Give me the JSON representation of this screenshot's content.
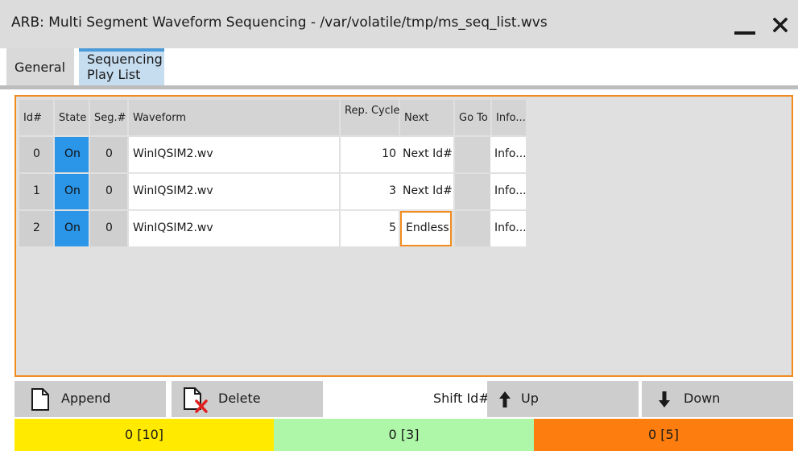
{
  "window": {
    "title": "ARB: Multi Segment Waveform Sequencing - /var/volatile/tmp/ms_seq_list.wvs",
    "minimize_icon": "minimize-icon",
    "close_icon": "close-icon"
  },
  "tabs": [
    {
      "label": "General",
      "active": false
    },
    {
      "label": "Sequencing Play List",
      "active": true
    }
  ],
  "table": {
    "columns": [
      "Id#",
      "State",
      "Seg.#",
      "Waveform",
      "Rep. Cycles",
      "Next",
      "Go To",
      "Info..."
    ],
    "rows": [
      {
        "id": "0",
        "state": "On",
        "seg": "0",
        "waveform": "WinIQSIM2.wv",
        "rep": "10",
        "next": "Next Id#",
        "goto": "",
        "info": "Info..."
      },
      {
        "id": "1",
        "state": "On",
        "seg": "0",
        "waveform": "WinIQSIM2.wv",
        "rep": "3",
        "next": "Next Id#",
        "goto": "",
        "info": "Info..."
      },
      {
        "id": "2",
        "state": "On",
        "seg": "0",
        "waveform": "WinIQSIM2.wv",
        "rep": "5",
        "next": "Endless",
        "goto": "",
        "info": "Info..."
      }
    ],
    "focused_cell": "row 2, Next"
  },
  "buttons": {
    "append": "Append",
    "delete": "Delete",
    "shift_label": "Shift Id#",
    "up": "Up",
    "down": "Down"
  },
  "status": {
    "segments": [
      {
        "text": "0 [10]",
        "color": "#ffea00"
      },
      {
        "text": "0 [3]",
        "color": "#aef7a8"
      },
      {
        "text": "0 [5]",
        "color": "#fd7e0e"
      }
    ]
  },
  "colors": {
    "accent_orange": "#f28c1f",
    "state_on_blue": "#2b95e8",
    "active_tab": "#c6dcef"
  }
}
